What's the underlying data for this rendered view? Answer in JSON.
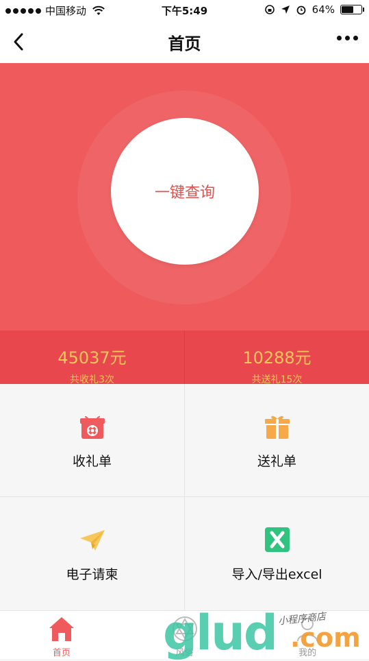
{
  "status_bar": {
    "carrier": "中国移动",
    "time": "下午5:49",
    "battery": "64%",
    "battery_level": 0.64
  },
  "nav": {
    "title": "首页"
  },
  "hero": {
    "query_button": "一键查询"
  },
  "stats": [
    {
      "amount": "45037元",
      "count": "共收礼3次"
    },
    {
      "amount": "10288元",
      "count": "共送礼15次"
    }
  ],
  "grid": [
    {
      "label": "收礼单",
      "icon": "gift-box-red-icon"
    },
    {
      "label": "送礼单",
      "icon": "gift-box-orange-icon"
    },
    {
      "label": "电子请柬",
      "icon": "paper-plane-icon"
    },
    {
      "label": "导入/导出excel",
      "icon": "excel-icon"
    }
  ],
  "tabbar": [
    {
      "label": "首页",
      "icon": "home-icon",
      "active": true
    },
    {
      "label": "风俗",
      "icon": "star-of-david-icon",
      "active": false
    },
    {
      "label": "我的",
      "icon": "user-icon",
      "active": false
    }
  ],
  "watermark": {
    "text": "glud",
    "suffix": ".com",
    "handwriting": "小程序商店"
  },
  "colors": {
    "hero": "#ef5b5d",
    "stats_bg": "#e8474d",
    "stat_text": "#f6c75a",
    "accent": "#ef5b5d"
  }
}
